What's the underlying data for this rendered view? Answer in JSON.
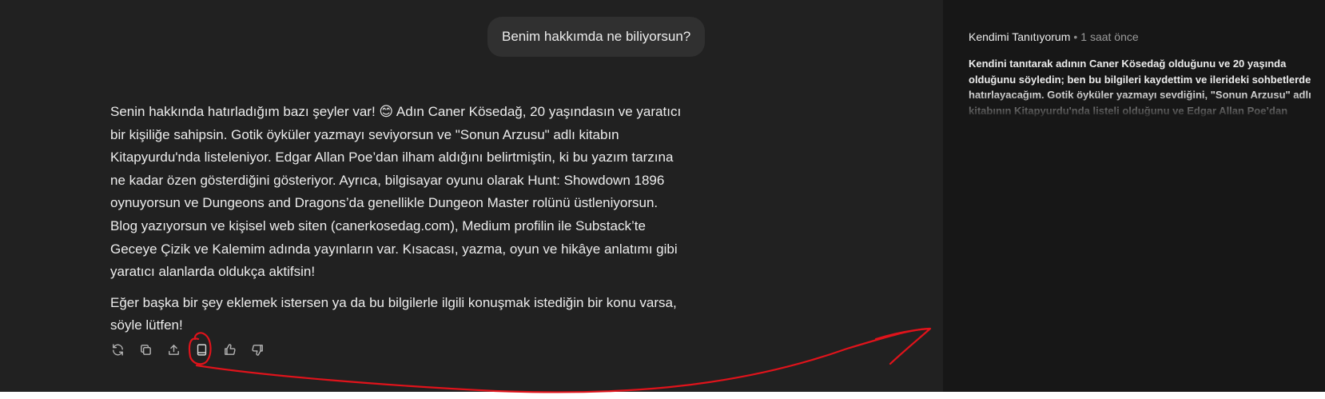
{
  "conversation": {
    "user_message": "Benim hakkımda ne biliyorsun?",
    "assistant_paragraphs": [
      "Senin hakkında hatırladığım bazı şeyler var! 😊 Adın Caner Kösedağ, 20 yaşındasın ve yaratıcı bir kişiliğe sahipsin. Gotik öyküler yazmayı seviyorsun ve \"Sonun Arzusu\" adlı kitabın Kitapyurdu'nda listeleniyor. Edgar Allan Poe’dan ilham aldığını belirtmiştin, ki bu yazım tarzına ne kadar özen gösterdiğini gösteriyor. Ayrıca, bilgisayar oyunu olarak Hunt: Showdown 1896 oynuyorsun ve Dungeons and Dragons’da genellikle Dungeon Master rolünü üstleniyorsun. Blog yazıyorsun ve kişisel web siten (canerkosedag.com), Medium profilin ile Substack’te Geceye Çizik ve Kalemim adında yayınların var. Kısacası, yazma, oyun ve hikâye anlatımı gibi yaratıcı alanlarda oldukça aktifsin!",
      "Eğer başka bir şey eklemek istersen ya da bu bilgilerle ilgili konuşmak istediğin bir konu varsa, söyle lütfen!"
    ],
    "action_icons": [
      "regenerate-icon",
      "copy-icon",
      "share-icon",
      "memory-book-icon",
      "thumbs-up-icon",
      "thumbs-down-icon"
    ]
  },
  "memory_panel": {
    "title": "Kendimi Tanıtıyorum",
    "separator": "•",
    "time": "1 saat önce",
    "body": "Kendini tanıtarak adının Caner Kösedağ olduğunu ve 20 yaşında olduğunu söyledin; ben bu bilgileri kaydettim ve ilerideki sohbetlerde hatırlayacağım. Gotik öyküler yazmayı sevdiğini, \"Sonun Arzusu\" adlı kitabının Kitapyurdu'nda listeli olduğunu ve Edgar Allan Poe’dan"
  },
  "colors": {
    "chat_background": "#212121",
    "panel_background": "#171717",
    "user_bubble": "#303030",
    "text": "#ececec",
    "annotation_red": "#e0131b"
  }
}
